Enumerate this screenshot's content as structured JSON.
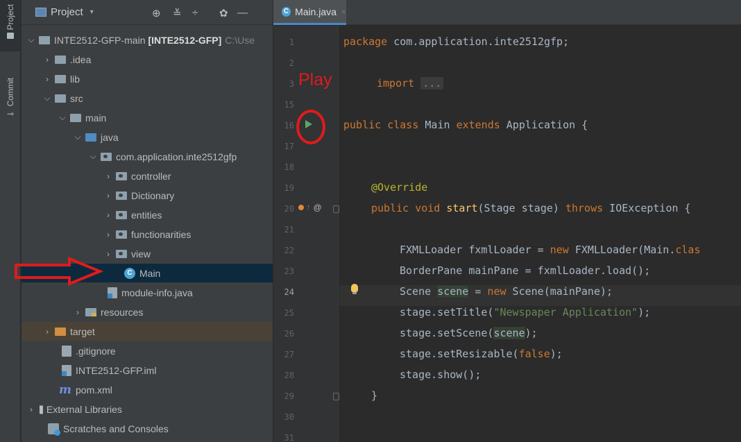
{
  "toolstrip": {
    "project_label": "Project",
    "commit_label": "Commit"
  },
  "panel": {
    "title": "Project",
    "caret": "▾",
    "icons": {
      "locate": "⊕",
      "collapse": "≚",
      "expand": "÷",
      "settings": "✿",
      "hide": "—"
    }
  },
  "tree": [
    {
      "label": "INTE2512-GFP-main",
      "bold": "[INTE2512-GFP]",
      "dim": "C:\\Use",
      "chev": "⌵",
      "icon": "project-folder"
    },
    {
      "label": ".idea",
      "chev": "›",
      "icon": "folder"
    },
    {
      "label": "lib",
      "chev": "›",
      "icon": "folder"
    },
    {
      "label": "src",
      "chev": "⌵",
      "icon": "folder"
    },
    {
      "label": "main",
      "chev": "⌵",
      "icon": "folder"
    },
    {
      "label": "java",
      "chev": "⌵",
      "icon": "source-folder"
    },
    {
      "label": "com.application.inte2512gfp",
      "chev": "⌵",
      "icon": "package"
    },
    {
      "label": "controller",
      "chev": "›",
      "icon": "package"
    },
    {
      "label": "Dictionary",
      "chev": "›",
      "icon": "package"
    },
    {
      "label": "entities",
      "chev": "›",
      "icon": "package"
    },
    {
      "label": "functionarities",
      "chev": "›",
      "icon": "package"
    },
    {
      "label": "view",
      "chev": "›",
      "icon": "package"
    },
    {
      "label": "Main",
      "chev": "",
      "icon": "class"
    },
    {
      "label": "module-info.java",
      "chev": "",
      "icon": "module-file"
    },
    {
      "label": "resources",
      "chev": "›",
      "icon": "resources-folder"
    },
    {
      "label": "target",
      "chev": "›",
      "icon": "excluded-folder"
    },
    {
      "label": ".gitignore",
      "chev": "",
      "icon": "file"
    },
    {
      "label": "INTE2512-GFP.iml",
      "chev": "",
      "icon": "file"
    },
    {
      "label": "pom.xml",
      "chev": "",
      "icon": "maven"
    },
    {
      "label": "External Libraries",
      "chev": "›",
      "icon": "libraries"
    },
    {
      "label": "Scratches and Consoles",
      "chev": "",
      "icon": "scratches"
    }
  ],
  "editor": {
    "tab_label": "Main.java",
    "tab_close": "×",
    "class_icon_letter": "C",
    "annotation_label": "Play",
    "override_at": "@",
    "line_numbers": [
      "1",
      "2",
      "3",
      "15",
      "16",
      "17",
      "18",
      "19",
      "20",
      "21",
      "22",
      "23",
      "24",
      "25",
      "26",
      "27",
      "28",
      "29",
      "30",
      "31"
    ],
    "code": {
      "l1_kw": "package",
      "l1_rest": " com.application.inte2512gfp;",
      "l3_kw": "import",
      "l3_dots": "...",
      "l16_kw": "public class",
      "l16_name": " Main ",
      "l16_kw2": "extends",
      "l16_rest": " Application {",
      "l19_ann": "@Override",
      "l20_kw": "public void",
      "l20_fn": "start",
      "l20_mid": "(Stage stage) ",
      "l20_kw2": "throws",
      "l20_rest": " IOException {",
      "l22_a": "FXMLLoader fxmlLoader = ",
      "l22_kw": "new",
      "l22_b": " FXMLLoader(Main.",
      "l22_kw2": "clas",
      "l23_a": "BorderPane mainPane = fxmlLoader.load();",
      "l24_a": "Scene ",
      "l24_var": "scene",
      "l24_b": " = ",
      "l24_kw": "new",
      "l24_c": " Scene(mainPane);",
      "l25_a": "stage.setTitle(",
      "l25_str": "\"Newspaper Application\"",
      "l25_b": ");",
      "l26_a": "stage.setScene(",
      "l26_var": "scene",
      "l26_b": ");",
      "l27_a": "stage.setResizable(",
      "l27_kw": "false",
      "l27_b": ");",
      "l28_a": "stage.show();",
      "l29_a": "}"
    }
  }
}
